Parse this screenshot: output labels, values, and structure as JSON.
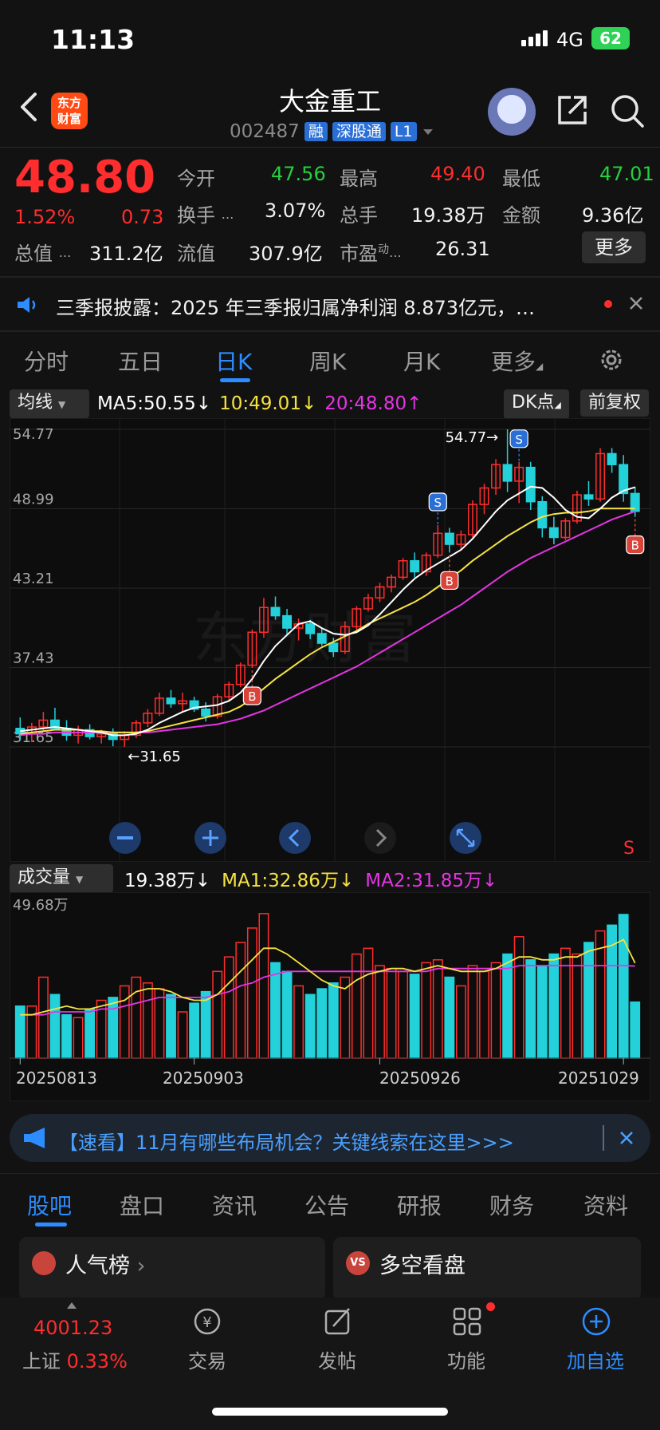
{
  "status": {
    "time": "11:13",
    "network": "4G",
    "battery": "62"
  },
  "header": {
    "logo_line1": "东方",
    "logo_line2": "财富",
    "title": "大金重工",
    "code": "002487",
    "tags": [
      "融",
      "深股通",
      "L1"
    ]
  },
  "quote": {
    "price": "48.80",
    "change_pct": "1.52%",
    "change": "0.73",
    "open_label": "今开",
    "open": "47.56",
    "high_label": "最高",
    "high": "49.40",
    "low_label": "最低",
    "low": "47.01",
    "turnover_label": "换手",
    "turnover": "3.07%",
    "volume_label": "总手",
    "volume": "19.38万",
    "amount_label": "金额",
    "amount": "9.36亿",
    "mktcap_label": "总值",
    "mktcap": "311.2亿",
    "float_label": "流值",
    "float": "307.9亿",
    "pe_label": "市盈",
    "pe_sup": "动",
    "pe": "26.31",
    "more": "更多"
  },
  "notice": {
    "text": "三季报披露：2025 年三季报归属净利润 8.873亿元，…"
  },
  "tabs": [
    "分时",
    "五日",
    "日K",
    "周K",
    "月K",
    "更多"
  ],
  "ma_bar": {
    "selector": "均线",
    "ma5": "MA5:50.55",
    "ma10": "10:49.01",
    "ma20": "20:48.80",
    "dk": "DK点",
    "adjust": "前复权"
  },
  "kline": {
    "y_labels": [
      "54.77",
      "48.99",
      "43.21",
      "37.43",
      "31.65"
    ],
    "max_label": "54.77→",
    "min_label": "←31.65",
    "signals": [
      "S",
      "S",
      "B",
      "B",
      "B"
    ],
    "watermark": "东方财富",
    "corner": "S"
  },
  "vol_bar": {
    "selector": "成交量",
    "vol": "19.38万",
    "ma1": "MA1:32.86万",
    "ma2": "MA2:31.85万",
    "max": "49.68万"
  },
  "dates": [
    "20250813",
    "20250903",
    "20250926",
    "20251029"
  ],
  "banner": {
    "text": "【速看】11月有哪些布局机会？关键线索在这里>>>"
  },
  "tabs2": [
    "股吧",
    "盘口",
    "资讯",
    "公告",
    "研报",
    "财务",
    "资料"
  ],
  "cards": {
    "left": "人气榜",
    "right": "多空看盘"
  },
  "bottom": {
    "index_value": "4001.23",
    "index_name": "上证",
    "index_pct": "0.33%",
    "trade": "交易",
    "post": "发帖",
    "func": "功能",
    "add": "加自选"
  },
  "colors": {
    "up": "#ff2d2d",
    "down": "#22d1d9",
    "accent": "#2d8cff",
    "ma5": "#ffffff",
    "ma10": "#f5e342",
    "ma20": "#e535e5"
  },
  "chart_data": {
    "type": "candlestick",
    "y_range": [
      31.65,
      54.77
    ],
    "candles": [
      [
        33.0,
        33.8,
        32.2,
        32.6
      ],
      [
        32.6,
        33.4,
        32.0,
        33.1
      ],
      [
        33.1,
        34.2,
        32.8,
        33.6
      ],
      [
        33.6,
        34.5,
        33.0,
        33.0
      ],
      [
        33.0,
        33.6,
        32.1,
        32.5
      ],
      [
        32.5,
        33.2,
        31.9,
        32.9
      ],
      [
        32.9,
        33.3,
        32.2,
        32.4
      ],
      [
        32.4,
        32.9,
        31.9,
        32.6
      ],
      [
        32.6,
        33.0,
        31.7,
        32.2
      ],
      [
        32.2,
        32.8,
        31.65,
        32.5
      ],
      [
        32.5,
        33.6,
        32.3,
        33.4
      ],
      [
        33.4,
        34.4,
        33.1,
        34.1
      ],
      [
        34.1,
        35.6,
        33.9,
        35.2
      ],
      [
        35.2,
        35.8,
        34.5,
        34.8
      ],
      [
        34.8,
        35.6,
        34.2,
        35.0
      ],
      [
        35.0,
        35.3,
        34.2,
        34.4
      ],
      [
        34.4,
        34.9,
        33.5,
        33.9
      ],
      [
        33.9,
        35.5,
        33.7,
        35.3
      ],
      [
        35.3,
        36.4,
        35.0,
        36.2
      ],
      [
        36.2,
        37.8,
        36.0,
        37.6
      ],
      [
        37.6,
        40.2,
        37.4,
        40.0
      ],
      [
        40.0,
        42.5,
        39.6,
        41.8
      ],
      [
        41.8,
        42.6,
        40.9,
        41.2
      ],
      [
        41.2,
        41.7,
        39.8,
        40.3
      ],
      [
        40.3,
        41.0,
        39.4,
        40.6
      ],
      [
        40.6,
        40.9,
        39.5,
        39.9
      ],
      [
        39.9,
        40.3,
        39.0,
        39.2
      ],
      [
        39.2,
        39.6,
        38.2,
        38.6
      ],
      [
        38.6,
        40.8,
        38.4,
        40.4
      ],
      [
        40.4,
        41.9,
        40.2,
        41.7
      ],
      [
        41.7,
        42.8,
        41.5,
        42.5
      ],
      [
        42.5,
        43.6,
        42.2,
        43.3
      ],
      [
        43.3,
        44.2,
        42.9,
        44.0
      ],
      [
        44.0,
        45.4,
        43.8,
        45.2
      ],
      [
        45.2,
        45.8,
        44.0,
        44.4
      ],
      [
        44.4,
        45.8,
        44.1,
        45.6
      ],
      [
        45.6,
        47.8,
        45.4,
        47.2
      ],
      [
        47.2,
        47.6,
        45.8,
        46.4
      ],
      [
        46.4,
        47.4,
        46.0,
        47.1
      ],
      [
        47.1,
        49.6,
        46.9,
        49.3
      ],
      [
        49.3,
        50.8,
        48.6,
        50.5
      ],
      [
        50.5,
        52.6,
        50.0,
        52.2
      ],
      [
        52.2,
        54.77,
        50.2,
        51.0
      ],
      [
        51.0,
        52.4,
        49.4,
        52.0
      ],
      [
        52.0,
        52.4,
        48.9,
        49.5
      ],
      [
        49.5,
        49.9,
        46.9,
        47.6
      ],
      [
        47.6,
        48.4,
        46.4,
        46.9
      ],
      [
        46.9,
        48.3,
        46.7,
        48.1
      ],
      [
        48.1,
        50.3,
        47.9,
        50.0
      ],
      [
        50.0,
        51.0,
        49.2,
        49.7
      ],
      [
        49.7,
        53.4,
        49.5,
        53.0
      ],
      [
        53.0,
        53.4,
        51.6,
        52.2
      ],
      [
        52.2,
        52.9,
        49.5,
        50.1
      ],
      [
        50.1,
        50.6,
        48.4,
        48.8
      ]
    ],
    "ma5": [
      32.8,
      32.9,
      33.0,
      33.1,
      33.0,
      32.9,
      32.8,
      32.7,
      32.5,
      32.5,
      32.6,
      32.9,
      33.4,
      33.8,
      34.2,
      34.5,
      34.6,
      34.7,
      35.0,
      35.6,
      36.6,
      37.9,
      39.0,
      39.8,
      40.6,
      40.8,
      40.3,
      39.9,
      39.8,
      40.0,
      40.5,
      41.3,
      42.2,
      43.1,
      43.9,
      44.5,
      45.0,
      45.5,
      46.0,
      46.8,
      47.8,
      48.8,
      49.6,
      50.1,
      50.6,
      50.5,
      49.8,
      48.9,
      48.4,
      48.3,
      49.0,
      49.8,
      50.3,
      50.55
    ],
    "ma10": [
      32.6,
      32.7,
      32.8,
      32.9,
      32.9,
      32.9,
      32.8,
      32.8,
      32.7,
      32.7,
      32.7,
      32.8,
      33.0,
      33.2,
      33.4,
      33.6,
      33.8,
      34.0,
      34.2,
      34.6,
      35.2,
      35.9,
      36.6,
      37.2,
      37.8,
      38.4,
      38.9,
      39.3,
      39.7,
      40.1,
      40.6,
      41.0,
      41.4,
      41.8,
      42.2,
      42.7,
      43.3,
      43.9,
      44.5,
      45.2,
      45.8,
      46.4,
      47.0,
      47.5,
      48.0,
      48.4,
      48.6,
      48.7,
      48.7,
      48.8,
      49.0,
      49.0,
      49.0,
      49.01
    ],
    "ma20": [
      32.5,
      32.6,
      32.6,
      32.7,
      32.7,
      32.7,
      32.7,
      32.7,
      32.7,
      32.7,
      32.7,
      32.7,
      32.8,
      32.9,
      33.0,
      33.1,
      33.2,
      33.3,
      33.5,
      33.7,
      34.0,
      34.3,
      34.7,
      35.1,
      35.5,
      35.9,
      36.3,
      36.7,
      37.1,
      37.5,
      38.0,
      38.5,
      39.0,
      39.5,
      40.0,
      40.5,
      41.0,
      41.5,
      42.0,
      42.6,
      43.2,
      43.8,
      44.4,
      44.9,
      45.4,
      45.8,
      46.2,
      46.6,
      47.0,
      47.4,
      47.8,
      48.2,
      48.5,
      48.8
    ],
    "volumes": [
      18,
      18,
      28,
      22,
      15,
      14,
      17,
      20,
      21,
      25,
      28,
      26,
      24,
      22,
      16,
      19,
      23,
      30,
      35,
      40,
      45,
      50,
      33,
      30,
      25,
      22,
      24,
      26,
      28,
      36,
      38,
      32,
      31,
      30,
      29,
      33,
      34,
      28,
      25,
      32,
      30,
      33,
      36,
      42,
      34,
      32,
      36,
      38,
      36,
      40,
      44,
      46,
      49.68,
      19.38
    ],
    "vol_ma1": [
      15,
      15,
      16,
      17,
      18,
      17,
      17,
      18,
      19,
      20,
      23,
      24,
      24,
      23,
      21,
      20,
      20,
      22,
      26,
      30,
      34,
      38,
      38,
      36,
      33,
      30,
      27,
      25,
      24,
      27,
      29,
      30,
      31,
      31,
      30,
      31,
      32,
      31,
      30,
      30,
      30,
      31,
      33,
      35,
      35,
      34,
      34,
      35,
      35,
      37,
      38,
      39,
      41,
      32.86
    ],
    "vol_ma2": [
      15,
      15,
      15,
      16,
      16,
      16,
      16,
      17,
      17,
      18,
      19,
      20,
      21,
      21,
      21,
      21,
      21,
      22,
      23,
      25,
      26,
      28,
      29,
      30,
      30,
      30,
      30,
      30,
      30,
      30,
      30,
      30,
      30,
      30,
      30,
      30,
      31,
      31,
      31,
      31,
      31,
      31,
      31,
      32,
      32,
      32,
      32,
      32,
      32,
      32,
      32,
      32,
      32,
      31.85
    ]
  }
}
